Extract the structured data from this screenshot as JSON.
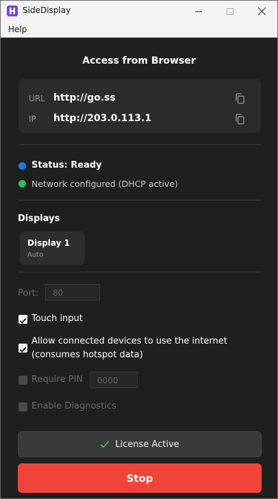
{
  "window": {
    "title": "SideDisplay"
  },
  "menu": {
    "help": "Help"
  },
  "access": {
    "heading": "Access from Browser",
    "url_key": "URL",
    "url_value": "http://go.ss",
    "ip_key": "IP",
    "ip_value": "http://203.0.113.1"
  },
  "status": {
    "ready": "Status: Ready",
    "ready_color": "#1a7de6",
    "network": "Network configured (DHCP active)",
    "network_color": "#2ac253"
  },
  "displays": {
    "heading": "Displays",
    "items": [
      {
        "name": "Display 1",
        "mode": "Auto"
      }
    ]
  },
  "settings": {
    "port_label": "Port:",
    "port_value": "80",
    "touch_label": "Touch input",
    "touch_checked": true,
    "internet_label_line1": "Allow connected devices to use the internet",
    "internet_label_line2": "(consumes hotspot data)",
    "internet_checked": true,
    "pin_label": "Require PIN",
    "pin_checked": false,
    "pin_value": "0000",
    "diagnostics_label": "Enable Diagnostics",
    "diagnostics_checked": false
  },
  "buttons": {
    "license": "License Active",
    "stop": "Stop",
    "stop_color": "#f0443a"
  }
}
